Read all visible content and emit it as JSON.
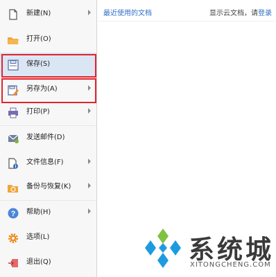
{
  "menu": {
    "items": [
      {
        "label": "新建(N)",
        "icon": "new-file-icon",
        "has_submenu": true
      },
      {
        "label": "打开(O)",
        "icon": "open-folder-icon",
        "has_submenu": false
      },
      {
        "label": "保存(S)",
        "icon": "save-icon",
        "has_submenu": false
      },
      {
        "label": "另存为(A)",
        "icon": "save-as-icon",
        "has_submenu": true
      },
      {
        "label": "打印(P)",
        "icon": "print-icon",
        "has_submenu": true
      },
      {
        "label": "发送邮件(D)",
        "icon": "email-icon",
        "has_submenu": false
      },
      {
        "label": "文件信息(F)",
        "icon": "file-info-icon",
        "has_submenu": true
      },
      {
        "label": "备份与恢复(K)",
        "icon": "backup-icon",
        "has_submenu": true
      },
      {
        "label": "帮助(H)",
        "icon": "help-icon",
        "has_submenu": true
      },
      {
        "label": "选项(L)",
        "icon": "gear-icon",
        "has_submenu": false
      },
      {
        "label": "退出(Q)",
        "icon": "exit-icon",
        "has_submenu": false
      }
    ],
    "active_item": "保存(S)"
  },
  "recent": {
    "title": "最近使用的文档",
    "cloud_prefix": "显示云文档，请",
    "login_label": "登录"
  },
  "watermark": {
    "brand_text": "系统城",
    "url_text": "XITONGCHENG.COM"
  },
  "colors": {
    "accent_blue": "#2f6fc8",
    "highlight_red": "#e3232b",
    "active_bg": "#dbe6f4",
    "watermark_blue": "#1e9be0"
  }
}
